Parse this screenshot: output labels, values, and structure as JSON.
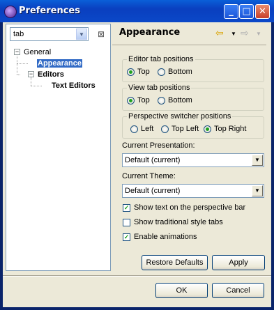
{
  "window": {
    "title": "Preferences"
  },
  "filter": {
    "value": "tab"
  },
  "tree": {
    "general": "General",
    "appearance": "Appearance",
    "editors": "Editors",
    "text_editors": "Text Editors"
  },
  "page": {
    "title": "Appearance"
  },
  "editor_tab": {
    "legend": "Editor tab positions",
    "options": [
      "Top",
      "Bottom"
    ],
    "selected": "Top"
  },
  "view_tab": {
    "legend": "View tab positions",
    "options": [
      "Top",
      "Bottom"
    ],
    "selected": "Top"
  },
  "perspective_switcher": {
    "legend": "Perspective switcher positions",
    "options": [
      "Left",
      "Top Left",
      "Top Right"
    ],
    "selected": "Top Right"
  },
  "presentation": {
    "label": "Current Presentation:",
    "value": "Default (current)"
  },
  "theme": {
    "label": "Current Theme:",
    "value": "Default (current)"
  },
  "checks": [
    {
      "label": "Show text on the perspective bar",
      "checked": true
    },
    {
      "label": "Show traditional style tabs",
      "checked": false
    },
    {
      "label": "Enable animations",
      "checked": true
    }
  ],
  "buttons": {
    "restore_defaults": "Restore Defaults",
    "apply": "Apply",
    "ok": "OK",
    "cancel": "Cancel"
  }
}
